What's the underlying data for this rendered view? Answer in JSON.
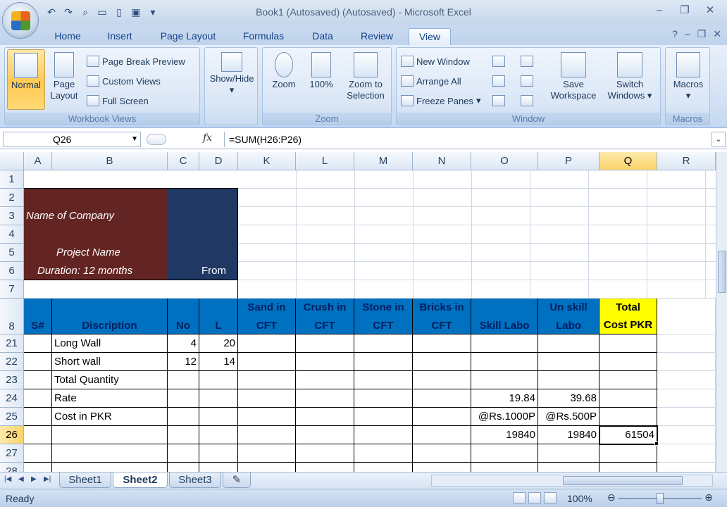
{
  "window": {
    "title": "Book1 (Autosaved) (Autosaved) - Microsoft Excel"
  },
  "qat": {
    "icons": [
      "undo-icon",
      "redo-icon",
      "print-preview-icon",
      "open-icon",
      "new-icon",
      "save-icon",
      "customize-icon"
    ]
  },
  "tabs": [
    "Home",
    "Insert",
    "Page Layout",
    "Formulas",
    "Data",
    "Review",
    "View"
  ],
  "active_tab": "View",
  "ribbon": {
    "workbook_views": {
      "label": "Workbook Views",
      "normal": "Normal",
      "page_layout_1": "Page",
      "page_layout_2": "Layout",
      "page_break": "Page Break Preview",
      "custom_views": "Custom Views",
      "full_screen": "Full Screen"
    },
    "show_hide": {
      "label": "Show/Hide"
    },
    "zoom": {
      "label": "Zoom",
      "zoom": "Zoom",
      "hundred": "100%",
      "zoom_sel_1": "Zoom to",
      "zoom_sel_2": "Selection"
    },
    "window": {
      "label": "Window",
      "new_window": "New Window",
      "arrange_all": "Arrange All",
      "freeze_panes": "Freeze Panes",
      "save_ws_1": "Save",
      "save_ws_2": "Workspace",
      "switch_1": "Switch",
      "switch_2": "Windows"
    },
    "macros": {
      "label": "Macros",
      "macros": "Macros"
    }
  },
  "formula_bar": {
    "name_box": "Q26",
    "fx": "fx",
    "formula": "=SUM(H26:P26)"
  },
  "columns": [
    "A",
    "B",
    "C",
    "D",
    "K",
    "L",
    "M",
    "N",
    "O",
    "P",
    "Q",
    "R"
  ],
  "selected_column": "Q",
  "rows": [
    "1",
    "2",
    "3",
    "4",
    "5",
    "6",
    "7",
    "8",
    "21",
    "22",
    "23",
    "24",
    "25",
    "26",
    "27",
    "28"
  ],
  "selected_row": "26",
  "header_block": {
    "company": "Name of Company",
    "project": "Project Name",
    "duration": "Duration: 12 months",
    "from": "From"
  },
  "table_headers": {
    "sno": "S#",
    "desc": "Discription",
    "no": "No",
    "l": "L",
    "sand_1": "Sand in",
    "sand_2": "CFT",
    "crush_1": "Crush in",
    "crush_2": "CFT",
    "stone_1": "Stone in",
    "stone_2": "CFT",
    "bricks_1": "Bricks in",
    "bricks_2": "CFT",
    "skill": "Skill Labo",
    "unskill_1": "Un skill",
    "unskill_2": "Labo",
    "total_1": "Total",
    "total_2": "Cost PKR"
  },
  "table_rows": [
    {
      "desc": "Long Wall",
      "no": "4",
      "l": "20",
      "o": "",
      "p": "",
      "q": ""
    },
    {
      "desc": "Short wall",
      "no": "12",
      "l": "14",
      "o": "",
      "p": "",
      "q": ""
    },
    {
      "desc": "Total Quantity",
      "no": "",
      "l": "",
      "o": "",
      "p": "",
      "q": ""
    },
    {
      "desc": "Rate",
      "no": "",
      "l": "",
      "o": "19.84",
      "p": "39.68",
      "q": ""
    },
    {
      "desc": "Cost in PKR",
      "no": "",
      "l": "",
      "o": "@Rs.1000P",
      "p": "@Rs.500P",
      "q": ""
    },
    {
      "desc": "",
      "no": "",
      "l": "",
      "o": "19840",
      "p": "19840",
      "q": "61504"
    }
  ],
  "sheets": [
    "Sheet1",
    "Sheet2",
    "Sheet3"
  ],
  "active_sheet": "Sheet2",
  "status": {
    "text": "Ready",
    "zoom": "100%"
  },
  "colors": {
    "header_blue": "#0070c0",
    "header_text": "#002060",
    "total_yellow": "#ffff00",
    "company_brown": "#632523",
    "navy": "#1f3864"
  }
}
